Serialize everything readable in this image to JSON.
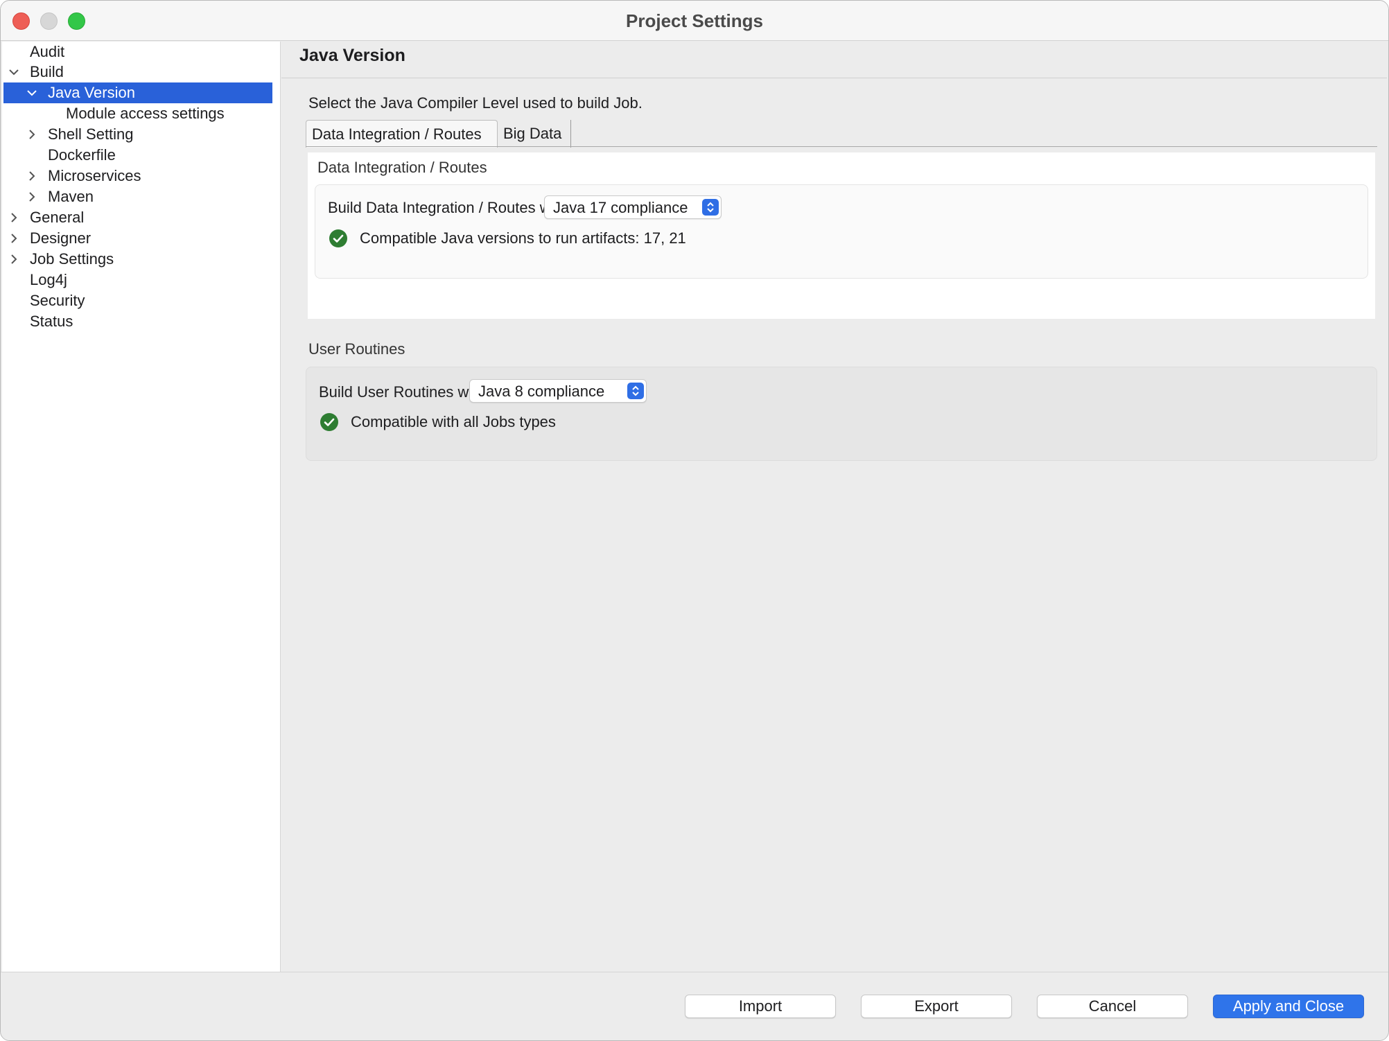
{
  "window": {
    "title": "Project Settings"
  },
  "sidebar": {
    "items": [
      {
        "label": "Audit",
        "expandable": false
      },
      {
        "label": "Build",
        "expanded": true
      },
      {
        "label": "Java Version",
        "expanded": true,
        "selected": true
      },
      {
        "label": "Module access settings",
        "expandable": false
      },
      {
        "label": "Shell Setting",
        "expanded": false
      },
      {
        "label": "Dockerfile",
        "expandable": false
      },
      {
        "label": "Microservices",
        "expanded": false
      },
      {
        "label": "Maven",
        "expanded": false
      },
      {
        "label": "General",
        "expanded": false
      },
      {
        "label": "Designer",
        "expanded": false
      },
      {
        "label": "Job Settings",
        "expanded": false
      },
      {
        "label": "Log4j",
        "expandable": false
      },
      {
        "label": "Security",
        "expandable": false
      },
      {
        "label": "Status",
        "expandable": false
      }
    ]
  },
  "main": {
    "section_title": "Java Version",
    "description": "Select the Java Compiler Level used to build Job.",
    "tabs": [
      {
        "label": "Data Integration / Routes",
        "active": true
      },
      {
        "label": "Big Data",
        "active": false
      }
    ],
    "di_panel": {
      "heading": "Data Integration / Routes",
      "build_label": "Build Data Integration / Routes with:",
      "build_value": "Java 17 compliance",
      "status_text": "Compatible Java versions to run artifacts: 17, 21"
    },
    "user_routines": {
      "heading": "User Routines",
      "build_label": "Build User Routines with",
      "build_value": "Java 8 compliance",
      "status_text": "Compatible with all Jobs types"
    }
  },
  "footer": {
    "import_label": "Import",
    "export_label": "Export",
    "cancel_label": "Cancel",
    "apply_label": "Apply and Close"
  },
  "colors": {
    "selection": "#2961d9",
    "accent": "#2f74ea",
    "success": "#2e7d32"
  }
}
